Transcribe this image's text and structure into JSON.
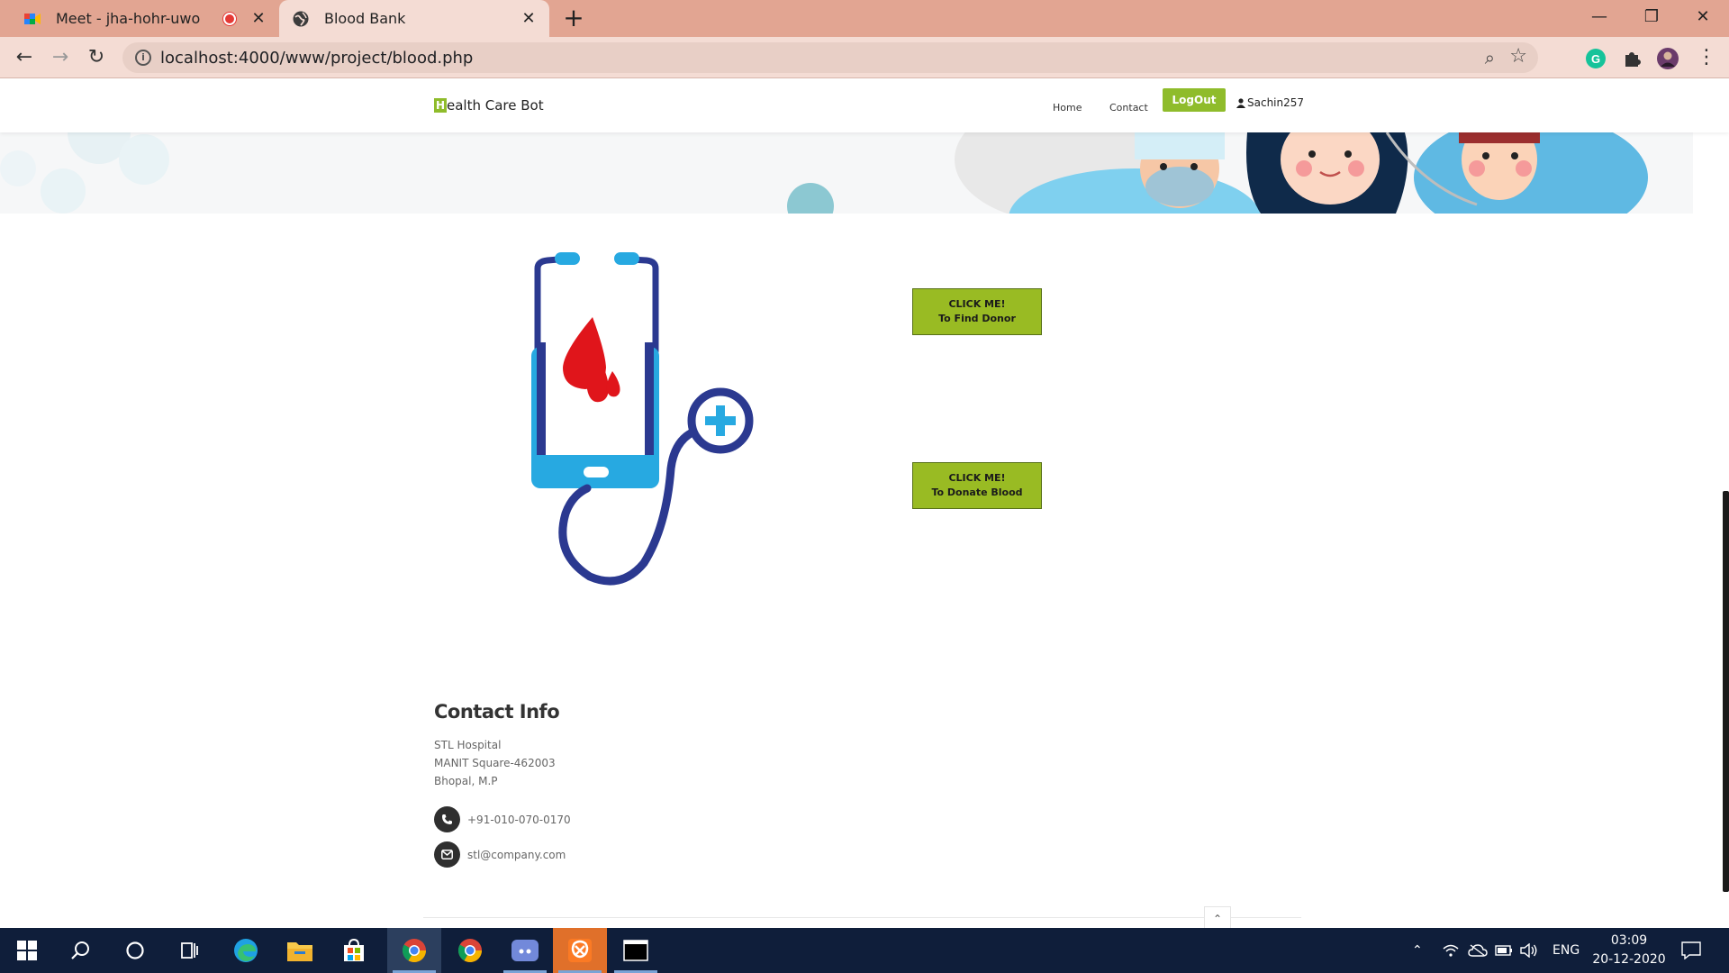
{
  "browser": {
    "tabs": [
      {
        "title": "Meet - jha-hohr-uwo",
        "active": false,
        "recording": true
      },
      {
        "title": "Blood Bank",
        "active": true
      }
    ],
    "address": "localhost:4000/www/project/blood.php",
    "new_tab_label": "+"
  },
  "site": {
    "brand_initial": "H",
    "brand_rest": "ealth Care Bot",
    "nav": {
      "home": "Home",
      "contact": "Contact",
      "logout": "LogOut",
      "username": "Sachin257"
    },
    "actions": {
      "find_line1": "CLICK ME!",
      "find_line2": "To Find Donor",
      "donate_line1": "CLICK ME!",
      "donate_line2": "To Donate Blood"
    },
    "contact": {
      "heading": "Contact Info",
      "address_line1": "STL Hospital",
      "address_line2": "MANIT Square-462003",
      "address_line3": "Bhopal, M.P",
      "phone": "+91-010-070-0170",
      "email": "stl@company.com"
    },
    "colors": {
      "accent_green": "#99bb23",
      "brand_green": "#8fbc2b",
      "dark_blue": "#2b3990",
      "light_blue": "#27a9e1",
      "blood_red": "#e0151b"
    }
  },
  "taskbar": {
    "language": "ENG",
    "time": "03:09",
    "date": "20-12-2020"
  }
}
